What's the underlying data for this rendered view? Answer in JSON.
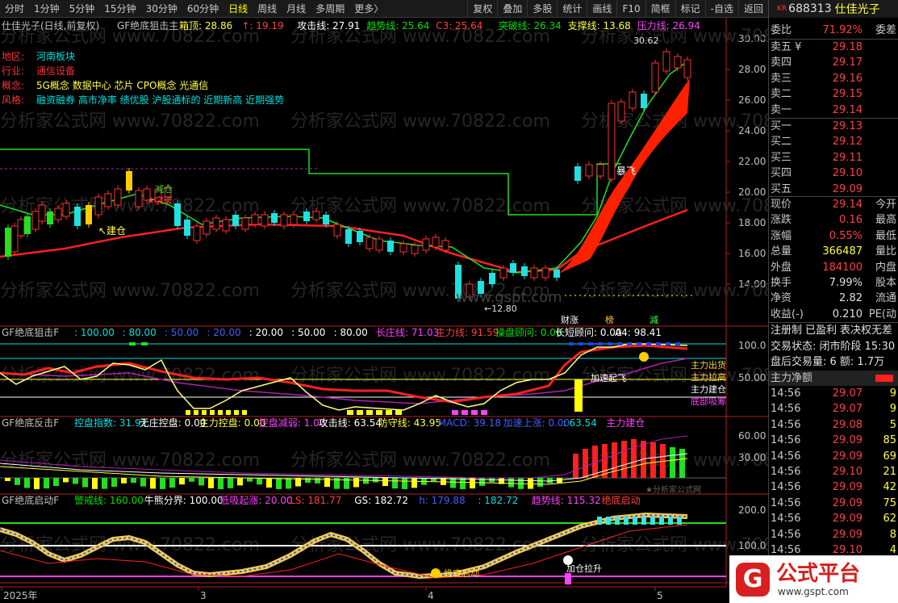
{
  "toolbar": {
    "periods": [
      "分时",
      "1分钟",
      "5分钟",
      "15分钟",
      "30分钟",
      "60分钟",
      "日线",
      "周线",
      "月线",
      "多周期",
      "更多〉"
    ],
    "active_period": "日线",
    "tools": [
      "复权",
      "叠加",
      "多股",
      "统计",
      "画线",
      "F10",
      "简框",
      "标记",
      "-自选",
      "返回"
    ]
  },
  "stock": {
    "market": "KR",
    "code": "688313",
    "name": "仕佳光子"
  },
  "main_pane": {
    "title": "仕佳光子(日线,前复权)",
    "indicator": "GF绝底狙击主",
    "params": [
      {
        "label": "箱顶: 28.86",
        "color": "#ffff40"
      },
      {
        "label": "↑: 19.19",
        "color": "#ff4040"
      },
      {
        "label": "攻击线: 27.91",
        "color": "#ffffff"
      },
      {
        "label": "趋势线: 25.64",
        "color": "#00e000"
      },
      {
        "label": "C3: 25.64",
        "color": "#ff4040"
      },
      {
        "label": "突破线: 26.34",
        "color": "#00e000"
      },
      {
        "label": "支撑线: 13.68",
        "color": "#ffff40"
      },
      {
        "label": "压力线: 26.94",
        "color": "#ff40ff"
      }
    ],
    "info": [
      {
        "key": "地区:",
        "val": "河南板块"
      },
      {
        "key": "行业:",
        "val": "通信设备"
      },
      {
        "key": "概念:",
        "val": "5G概念 数据中心 芯片 CPO概念 光通信"
      },
      {
        "key": "风格:",
        "val": "融资融券 高市净率 绩优股 沪股通标的 近期新高 近期强势"
      }
    ],
    "yaxis": [
      "30.00",
      "28.00",
      "26.00",
      "24.00",
      "22.00",
      "20.00",
      "18.00",
      "16.00",
      "14.00"
    ],
    "annotations": {
      "high": "30.62",
      "low": "12.80",
      "jiancang": "建仓",
      "tupo": "突破",
      "jinjian": "减仓",
      "feizhang": "暴飞",
      "cai": "财涨",
      "bang": "榜",
      "jian": "減"
    }
  },
  "pane2": {
    "indicator": "GF绝底狙击F",
    "params": [
      {
        "label": ": 100.00",
        "color": "#00e0e0"
      },
      {
        "label": ": 80.00",
        "color": "#00e0e0"
      },
      {
        "label": ": 50.00",
        "color": "#4060ff"
      },
      {
        "label": ": 20.00",
        "color": "#4060ff"
      },
      {
        "label": ": 20.00",
        "color": "#ffffff"
      },
      {
        "label": ": 50.00",
        "color": "#ffffff"
      },
      {
        "label": ": 80.00",
        "color": "#ffffff"
      },
      {
        "label": "长庄线: 71.03",
        "color": "#ff40ff"
      },
      {
        "label": "主力线: 91.59",
        "color": "#ff4040"
      },
      {
        "label": "操盘顾问: 0.00",
        "color": "#00e000"
      },
      {
        "label": "长短顾问: 0.00",
        "color": "#ffffff"
      },
      {
        "label": "A4: 98.41",
        "color": "#ffffff"
      }
    ],
    "yaxis": [
      "100.0",
      "50.00"
    ],
    "labels": {
      "chu": "主力出货",
      "la": "主力拉高",
      "jc": "主力建仓",
      "xi": "底部吸筹",
      "js": "加速起飞"
    }
  },
  "pane3": {
    "indicator": "GF绝底反击F",
    "params": [
      {
        "label": "控盘指数: 31.92",
        "color": "#00e0e0"
      },
      {
        "label": "无庄控盘: 0.00",
        "color": "#ffffff"
      },
      {
        "label": "主力控盘: 0.00",
        "color": "#ffff40"
      },
      {
        "label": "控盘减弱: 1.00",
        "color": "#ff40ff"
      },
      {
        "label": "攻击线: 63.54",
        "color": "#ffffff"
      },
      {
        "label": "防守线: 43.95",
        "color": "#ffff40"
      },
      {
        "label": "MACD: 39.18",
        "color": "#4060ff"
      },
      {
        "label": "加速上涨: 0.00",
        "color": "#4060ff"
      },
      {
        "label": ": 63.54",
        "color": "#00e0e0"
      },
      {
        "label": "主力建仓",
        "color": "#ff40ff"
      }
    ],
    "yaxis": [
      "60.00",
      "30.00"
    ],
    "watermark": "★分析家公式网"
  },
  "pane4": {
    "indicator": "GF绝底启动F",
    "params": [
      {
        "label": "警戒线: 160.00",
        "color": "#00e000"
      },
      {
        "label": "牛熊分界: 100.00",
        "color": "#ffffff"
      },
      {
        "label": "低吸起涨: 20.00",
        "color": "#ff40ff"
      },
      {
        "label": "LS: 181.77",
        "color": "#ff4040"
      },
      {
        "label": "GS: 182.72",
        "color": "#ffffff"
      },
      {
        "label": "h: 179.88",
        "color": "#4060ff"
      },
      {
        "label": ": 182.72",
        "color": "#00e0e0"
      },
      {
        "label": "趋势线: 115.32",
        "color": "#ff40ff"
      },
      {
        "label": "绝底启动",
        "color": "#ff4040"
      }
    ],
    "yaxis": [
      "200.0",
      "100.0"
    ],
    "labels": {
      "qd": "绝底启动",
      "jc": "加仓拉升"
    }
  },
  "xaxis": {
    "labels": [
      "2025年",
      "3",
      "4",
      "5"
    ]
  },
  "watermarks": {
    "main": "分析家公式网 www.70822.com",
    "gspt": "www.gspt.com"
  },
  "quote": {
    "ratio": {
      "label": "委比",
      "value": "71.92%",
      "right": "委差"
    },
    "asks": [
      {
        "label": "卖五 ¥",
        "price": "29.18"
      },
      {
        "label": "卖四",
        "price": "29.17"
      },
      {
        "label": "卖三",
        "price": "29.16"
      },
      {
        "label": "卖二",
        "price": "29.15"
      },
      {
        "label": "卖一",
        "price": "29.14"
      }
    ],
    "bids": [
      {
        "label": "买一",
        "price": "29.13"
      },
      {
        "label": "买二",
        "price": "29.12"
      },
      {
        "label": "买三",
        "price": "29.11"
      },
      {
        "label": "买四",
        "price": "29.10"
      },
      {
        "label": "买五",
        "price": "29.09"
      }
    ],
    "stats": [
      {
        "label": "现价",
        "value": "29.14",
        "right": "今开",
        "color": "#ff4040"
      },
      {
        "label": "涨跌",
        "value": "0.16",
        "right": "最高",
        "color": "#ff4040"
      },
      {
        "label": "涨幅",
        "value": "0.55%",
        "right": "最低",
        "color": "#ff4040"
      },
      {
        "label": "总量",
        "value": "366487",
        "right": "量比",
        "color": "#ffff40"
      },
      {
        "label": "外盘",
        "value": "184100",
        "right": "内盘",
        "color": "#ff4040"
      },
      {
        "label": "换手",
        "value": "7.99%",
        "right": "股本",
        "color": "#e0e0e0"
      },
      {
        "label": "净资",
        "value": "2.82",
        "right": "流通",
        "color": "#e0e0e0"
      },
      {
        "label": "收益(-)",
        "value": "0.210",
        "right": "PE(动",
        "color": "#e0e0e0"
      }
    ],
    "tabs": [
      "注册制",
      "已盈利",
      "表决权无差"
    ],
    "status": "交易状态: 闭市阶段 15:30",
    "after": "盘后交易量: 6  额: 1.7万",
    "flow_label": "主力净额"
  },
  "ticks": [
    {
      "time": "14:56",
      "price": "29.07",
      "vol": "9"
    },
    {
      "time": "14:56",
      "price": "29.07",
      "vol": "9"
    },
    {
      "time": "14:56",
      "price": "29.08",
      "vol": "5"
    },
    {
      "time": "14:56",
      "price": "29.09",
      "vol": "85"
    },
    {
      "time": "14:56",
      "price": "29.09",
      "vol": "69"
    },
    {
      "time": "14:56",
      "price": "29.10",
      "vol": "21"
    },
    {
      "time": "14:56",
      "price": "29.09",
      "vol": "42"
    },
    {
      "time": "14:56",
      "price": "29.09",
      "vol": "75"
    },
    {
      "time": "14:56",
      "price": "29.09",
      "vol": "62"
    },
    {
      "time": "14:56",
      "price": "29.09",
      "vol": "8"
    },
    {
      "time": "14:56",
      "price": "29.10",
      "vol": "4"
    }
  ],
  "logo": {
    "title": "公式平台",
    "url": "www.gspt.com"
  }
}
